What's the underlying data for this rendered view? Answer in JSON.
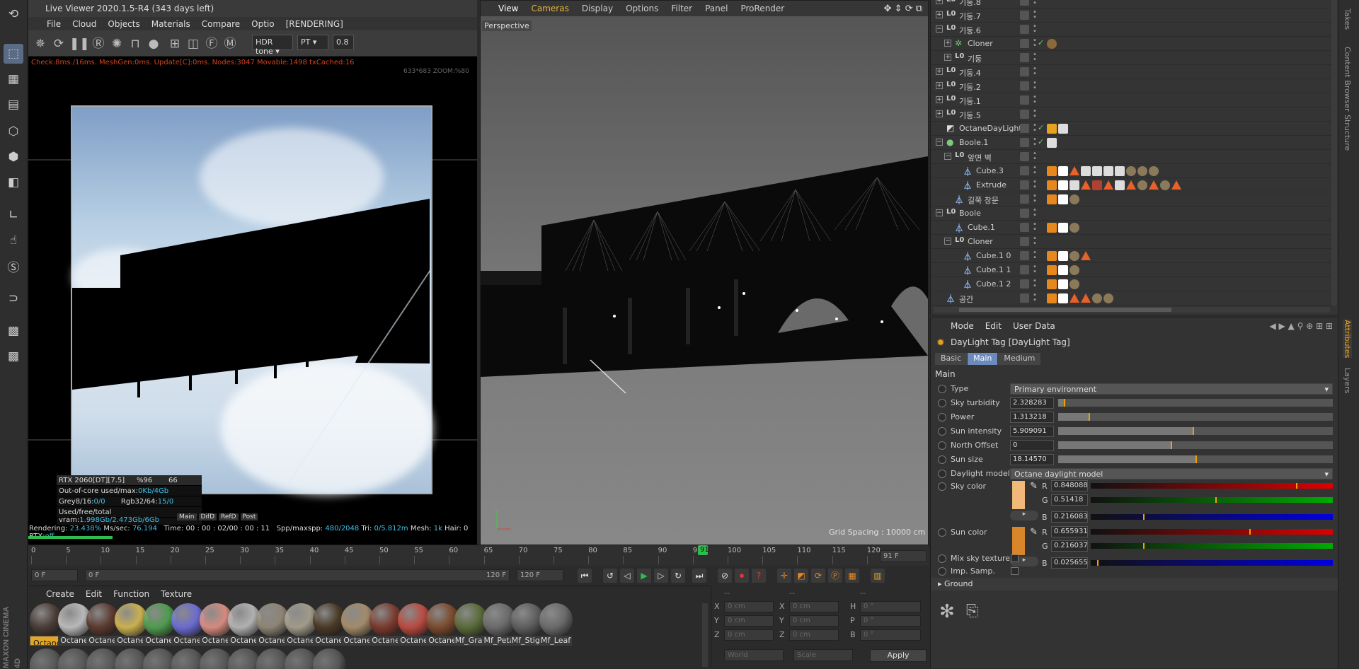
{
  "left_toolbar": {
    "brand_line1": "MAXON",
    "brand_line2": "CINEMA 4D"
  },
  "live_viewer": {
    "title": "Live Viewer 2020.1.5-R4 (343 days left)",
    "menu": [
      "File",
      "Cloud",
      "Objects",
      "Materials",
      "Compare",
      "Optio"
    ],
    "menu_status": "[RENDERING]",
    "tonemap": "HDR tone",
    "kernel": "PT",
    "value": "0.8",
    "status_line": "Check:8ms./16ms. MeshGen:0ms. Update[C]:0ms. Nodes:3047 Movable:1498 txCached:16",
    "hud": "633*683 ZOOM:%80",
    "gpu": {
      "name": "RTX 2060[DT][7.5]",
      "pct": "%96",
      "temp": "66"
    },
    "ooc_label": "Out-of-core used/max:",
    "ooc_value": "0Kb/4Gb",
    "grey_label": "Grey8/16:",
    "grey_value": "0/0",
    "rgb_label": "Rgb32/64:",
    "rgb_value": "15/0",
    "vram_label": "Used/free/total vram:",
    "vram_value": "1.998Gb/2.473Gb/6Gb",
    "passes": [
      "Main",
      "DifD",
      "RefD",
      "Post"
    ],
    "render_stats": {
      "rendering_label": "Rendering:",
      "rendering_value": "23.438%",
      "ms_label": "Ms/sec:",
      "ms_value": "76.194",
      "time_label": "Time:",
      "time_value": "00 : 00 : 02/00 : 00 : 11",
      "spp_label": "Spp/maxspp:",
      "spp_value": "480/2048",
      "tri_label": "Tri:",
      "tri_value": "0/5.812m",
      "mesh_label": "Mesh:",
      "mesh_value": "1k",
      "hair_label": "Hair:",
      "hair_value": "0",
      "rtx_label": "RTX:",
      "rtx_value": "off"
    },
    "progress": 0.234
  },
  "viewport": {
    "menu": [
      "View",
      "Cameras",
      "Display",
      "Options",
      "Filter",
      "Panel",
      "ProRender"
    ],
    "camera_label": "Perspective",
    "grid_spacing": "Grid Spacing : 10000 cm"
  },
  "timeline": {
    "ticks": [
      "0",
      "5",
      "10",
      "15",
      "20",
      "25",
      "30",
      "35",
      "40",
      "45",
      "50",
      "55",
      "60",
      "65",
      "70",
      "75",
      "80",
      "85",
      "90",
      "95",
      "100",
      "105",
      "110",
      "115",
      "120"
    ],
    "current_frame": "91",
    "frame_display": "91 F",
    "start": "0 F",
    "min": "0 F",
    "max": "120 F",
    "end": "120 F"
  },
  "material_manager": {
    "menu": [
      "Create",
      "Edit",
      "Function",
      "Texture"
    ],
    "materials": [
      {
        "name": "Octane",
        "color": "#4a3c36"
      },
      {
        "name": "Octane",
        "color": "#b8b8b8"
      },
      {
        "name": "Octane",
        "color": "#5a3a30"
      },
      {
        "name": "Octane",
        "color": "#c9b050"
      },
      {
        "name": "Octane",
        "color": "#4f9a4f"
      },
      {
        "name": "Octane",
        "color": "#6b6bd0"
      },
      {
        "name": "Octane",
        "color": "#d48a7f"
      },
      {
        "name": "Octane",
        "color": "#b0b0b0"
      },
      {
        "name": "Octane",
        "color": "#8c8474"
      },
      {
        "name": "Octane",
        "color": "#a09a88"
      },
      {
        "name": "Octane",
        "color": "#4a3a26"
      },
      {
        "name": "Octane",
        "color": "#a28a6a"
      },
      {
        "name": "Octane",
        "color": "#7a3a2e"
      },
      {
        "name": "Octane",
        "color": "#b84a40"
      },
      {
        "name": "Octane",
        "color": "#7a4a2e"
      },
      {
        "name": "Mf_Gras",
        "color": "#5a6a3a"
      },
      {
        "name": "Mf_Peta",
        "color": "#6a6a6a"
      },
      {
        "name": "Mf_Stigr",
        "color": "#5e5e5e"
      },
      {
        "name": "Mf_Leaf",
        "color": "#6a6a6a"
      }
    ]
  },
  "coordinates": {
    "cols": [
      "--",
      "--",
      "--"
    ],
    "rows": [
      {
        "a": "X",
        "av": "0 cm",
        "b": "X",
        "bv": "0 cm",
        "c": "H",
        "cv": "0 °"
      },
      {
        "a": "Y",
        "av": "0 cm",
        "b": "Y",
        "bv": "0 cm",
        "c": "P",
        "cv": "0 °"
      },
      {
        "a": "Z",
        "av": "0 cm",
        "b": "Z",
        "bv": "0 cm",
        "c": "B",
        "cv": "0 °"
      }
    ],
    "world": "World",
    "scale": "Scale",
    "apply": "Apply"
  },
  "object_manager": {
    "rows": [
      {
        "name": "기둥.8"
      },
      {
        "name": "기둥.7"
      },
      {
        "name": "기둥.6"
      },
      {
        "name": "Cloner"
      },
      {
        "name": "기둥"
      },
      {
        "name": "기둥.4"
      },
      {
        "name": "기둥.2"
      },
      {
        "name": "기둥.1"
      },
      {
        "name": "기둥.5"
      },
      {
        "name": "OctaneDayLight"
      },
      {
        "name": "Boole.1"
      },
      {
        "name": "앞면 벽"
      },
      {
        "name": "Cube.3"
      },
      {
        "name": "Extrude"
      },
      {
        "name": "길쭉 창문"
      },
      {
        "name": "Boole"
      },
      {
        "name": "Cube.1"
      },
      {
        "name": "Cloner"
      },
      {
        "name": "Cube.1 0"
      },
      {
        "name": "Cube.1 1"
      },
      {
        "name": "Cube.1 2"
      },
      {
        "name": "공간"
      }
    ]
  },
  "attributes": {
    "menu": [
      "Mode",
      "Edit",
      "User Data"
    ],
    "title": "DayLight Tag [DayLight Tag]",
    "tabs": [
      "Basic",
      "Main",
      "Medium"
    ],
    "section": "Main",
    "type_label": "Type",
    "type_value": "Primary environment",
    "sliders": [
      {
        "label": "Sky turbidity",
        "value": "2.328283",
        "fraction": 0.02
      },
      {
        "label": "Power",
        "value": "1.313218",
        "fraction": 0.11
      },
      {
        "label": "Sun intensity",
        "value": "5.909091",
        "fraction": 0.49
      },
      {
        "label": "North Offset",
        "value": "0",
        "fraction": 0.41
      },
      {
        "label": "Sun size",
        "value": "18.14570",
        "fraction": 0.5
      }
    ],
    "model_label": "Daylight model",
    "model_value": "Octane daylight model",
    "sky_color": {
      "label": "Sky color",
      "swatch": "#f0b97a",
      "r": "0.848088",
      "g": "0.51418",
      "b": "0.216083",
      "rf": 0.848088,
      "gf": 0.51418,
      "bf": 0.216083
    },
    "sun_color": {
      "label": "Sun color",
      "swatch": "#d9852a",
      "r": "0.655931",
      "g": "0.216037",
      "b": "0.025655",
      "rf": 0.655931,
      "gf": 0.216037,
      "bf": 0.025655
    },
    "mix_label": "Mix sky texture",
    "imp_label": "Imp. Samp.",
    "ground_label": "Ground"
  },
  "right_tabs": [
    "Takes",
    "Content Browser",
    "Structure",
    "Attributes",
    "Layers"
  ]
}
